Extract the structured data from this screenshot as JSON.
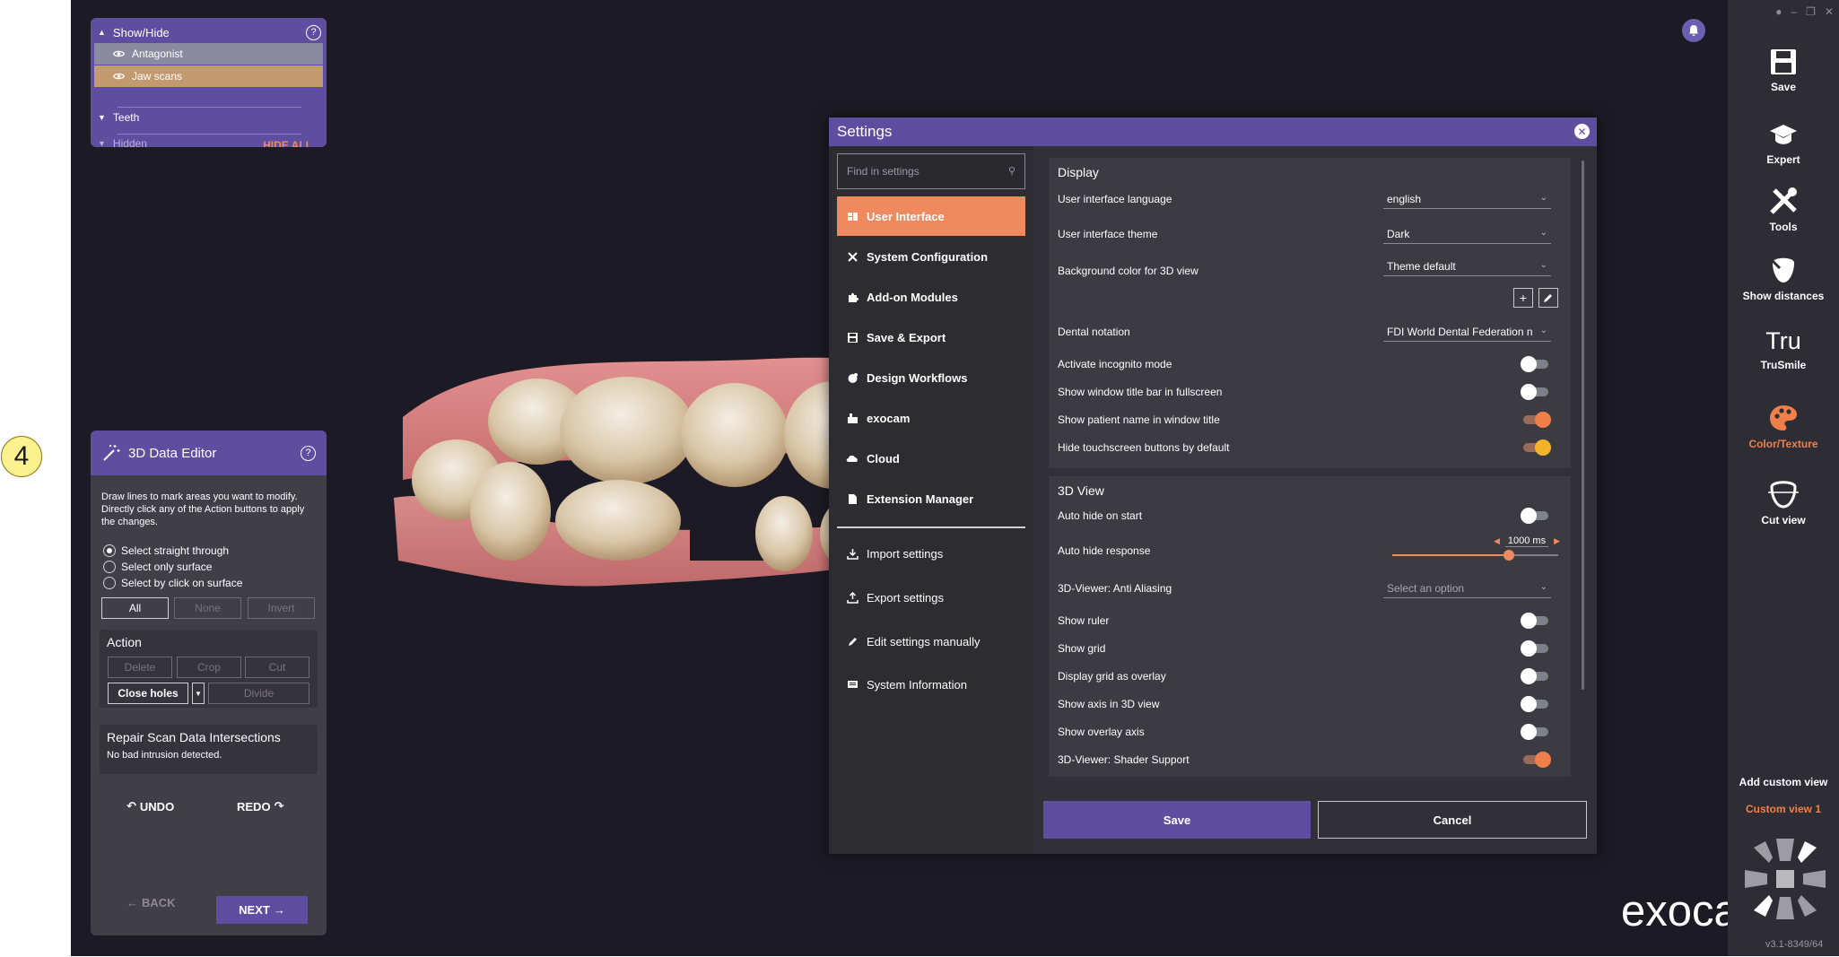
{
  "marker": {
    "label": "4"
  },
  "show_hide": {
    "title": "Show/Hide",
    "items": [
      {
        "label": "Antagonist"
      },
      {
        "label": "Jaw scans"
      }
    ],
    "teeth_label": "Teeth",
    "hidden_label": "Hidden",
    "hide_all_label": "HIDE ALL"
  },
  "editor": {
    "title": "3D Data Editor",
    "description": "Draw lines to mark areas you want to modify. Directly click any of the Action buttons to apply the changes.",
    "radios": [
      {
        "label": "Select straight through",
        "selected": true
      },
      {
        "label": "Select only surface",
        "selected": false
      },
      {
        "label": "Select by click on surface",
        "selected": false
      }
    ],
    "select_buttons": {
      "all": "All",
      "none": "None",
      "invert": "Invert"
    },
    "action": {
      "title": "Action",
      "delete": "Delete",
      "crop": "Crop",
      "cut": "Cut",
      "close_holes": "Close holes",
      "divide": "Divide"
    },
    "repair": {
      "title": "Repair Scan Data Intersections",
      "status": "No bad intrusion detected."
    },
    "undo": "UNDO",
    "redo": "REDO",
    "back": "BACK",
    "next": "NEXT"
  },
  "settings": {
    "title": "Settings",
    "search_placeholder": "Find in settings",
    "nav": [
      {
        "label": "User Interface",
        "icon": "user-interface-icon",
        "active": true
      },
      {
        "label": "System Configuration",
        "icon": "tools-icon",
        "active": false
      },
      {
        "label": "Add-on Modules",
        "icon": "puzzle-icon",
        "active": false
      },
      {
        "label": "Save & Export",
        "icon": "save-icon",
        "active": false
      },
      {
        "label": "Design Workflows",
        "icon": "workflow-icon",
        "active": false
      },
      {
        "label": "exocam",
        "icon": "camera-icon",
        "active": false
      },
      {
        "label": "Cloud",
        "icon": "cloud-icon",
        "active": false
      },
      {
        "label": "Extension Manager",
        "icon": "extension-icon",
        "active": false
      }
    ],
    "nav_secondary": [
      {
        "label": "Import settings",
        "icon": "import-icon"
      },
      {
        "label": "Export settings",
        "icon": "export-icon"
      },
      {
        "label": "Edit settings manually",
        "icon": "pencil-icon"
      },
      {
        "label": "System Information",
        "icon": "info-icon"
      }
    ],
    "display": {
      "title": "Display",
      "language_label": "User interface language",
      "language_value": "english",
      "theme_label": "User interface theme",
      "theme_value": "Dark",
      "bg_label": "Background color for 3D view",
      "bg_value": "Theme default",
      "notation_label": "Dental notation",
      "notation_value": "FDI World Dental Federation n",
      "incognito_label": "Activate incognito mode",
      "incognito_on": false,
      "titlebar_label": "Show window title bar in fullscreen",
      "titlebar_on": false,
      "patient_label": "Show patient name in window title",
      "patient_on": true,
      "touch_label": "Hide touchscreen buttons by default",
      "touch_on": true
    },
    "view3d": {
      "title": "3D View",
      "autohide_label": "Auto hide on start",
      "autohide_on": false,
      "response_label": "Auto hide response",
      "response_value": "1000 ms",
      "response_fraction": 0.7,
      "aa_label": "3D-Viewer: Anti Aliasing",
      "aa_placeholder": "Select an option",
      "ruler_label": "Show ruler",
      "ruler_on": false,
      "grid_label": "Show grid",
      "grid_on": false,
      "overlay_label": "Display grid as overlay",
      "overlay_on": false,
      "axis_label": "Show axis in 3D view",
      "axis_on": false,
      "overlay_axis_label": "Show overlay axis",
      "overlay_axis_on": false,
      "shader_label": "3D-Viewer: Shader Support",
      "shader_on": true
    },
    "save": "Save",
    "cancel": "Cancel"
  },
  "toolbar": {
    "save": "Save",
    "expert": "Expert",
    "tools": "Tools",
    "show_distances": "Show distances",
    "trusmile": "TruSmile",
    "trusmile_glyph": "Tru",
    "color_texture": "Color/Texture",
    "cut_view": "Cut view",
    "add_custom_view": "Add custom view",
    "custom_view_1": "Custom view 1"
  },
  "brand": {
    "logo": "exocad",
    "version": "v3.1-8349/64"
  },
  "colors": {
    "accent_purple": "#5d4ea0",
    "accent_orange": "#ef8a5e",
    "viewport_bg": "#1c1a24"
  }
}
